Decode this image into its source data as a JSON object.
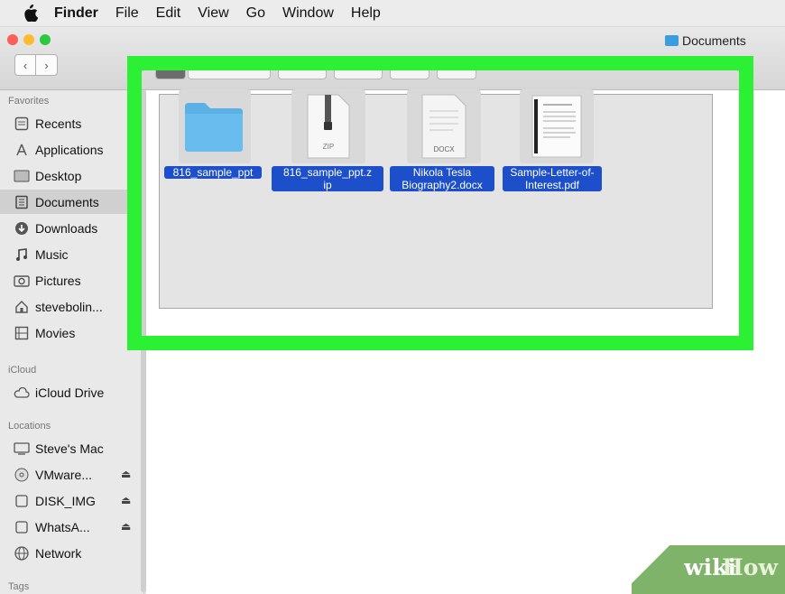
{
  "menubar": {
    "app": "Finder",
    "items": [
      "File",
      "Edit",
      "View",
      "Go",
      "Window",
      "Help"
    ]
  },
  "window": {
    "title": "Documents",
    "nav": {
      "back": "‹",
      "forward": "›"
    }
  },
  "sidebar": {
    "favorites_label": "Favorites",
    "favorites": [
      {
        "label": "Recents",
        "icon": "recents-icon"
      },
      {
        "label": "Applications",
        "icon": "applications-icon"
      },
      {
        "label": "Desktop",
        "icon": "desktop-icon"
      },
      {
        "label": "Documents",
        "icon": "documents-icon",
        "selected": true
      },
      {
        "label": "Downloads",
        "icon": "downloads-icon"
      },
      {
        "label": "Music",
        "icon": "music-icon"
      },
      {
        "label": "Pictures",
        "icon": "pictures-icon"
      },
      {
        "label": "stevebolin...",
        "icon": "home-icon"
      },
      {
        "label": "Movies",
        "icon": "movies-icon"
      }
    ],
    "icloud_label": "iCloud",
    "icloud": [
      {
        "label": "iCloud Drive",
        "icon": "icloud-icon"
      }
    ],
    "locations_label": "Locations",
    "locations": [
      {
        "label": "Steve's Mac",
        "icon": "computer-icon"
      },
      {
        "label": "VMware...",
        "icon": "disc-icon",
        "eject": "⏏"
      },
      {
        "label": "DISK_IMG",
        "icon": "disk-icon",
        "eject": "⏏"
      },
      {
        "label": "WhatsA...",
        "icon": "disk-icon",
        "eject": "⏏"
      },
      {
        "label": "Network",
        "icon": "network-icon"
      }
    ],
    "tags_label": "Tags"
  },
  "files": [
    {
      "name_lines": [
        "816_sample_ppt"
      ],
      "type": "folder",
      "badge": ""
    },
    {
      "name_lines": [
        "816_sample_ppt.z",
        "ip"
      ],
      "type": "zip",
      "badge": "ZIP"
    },
    {
      "name_lines": [
        "Nikola Tesla",
        "Biography2.docx"
      ],
      "type": "docx",
      "badge": "DOCX"
    },
    {
      "name_lines": [
        "Sample-Letter-of-",
        "Interest.pdf"
      ],
      "type": "pdf",
      "badge": ""
    }
  ],
  "watermark": {
    "part1": "wiki",
    "part2": "How"
  },
  "colors": {
    "highlight": "#2cf033",
    "selection": "#1c4fc9",
    "folder": "#5bb1e6"
  }
}
